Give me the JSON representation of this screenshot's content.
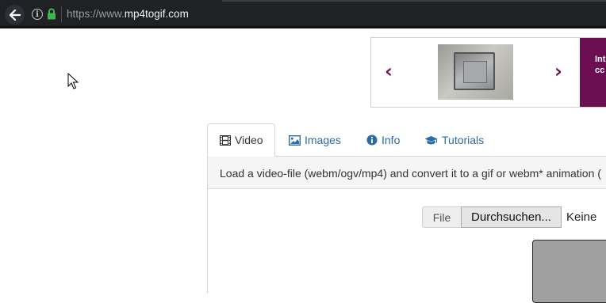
{
  "browser": {
    "url_prefix": "https://www.",
    "url_domain": "mp4togif.com"
  },
  "carousel": {
    "panel_text": "Int\ncc"
  },
  "tabs": [
    {
      "label": "Video",
      "icon": "film-icon",
      "active": true
    },
    {
      "label": "Images",
      "icon": "image-icon",
      "active": false
    },
    {
      "label": "Info",
      "icon": "info-circle-icon",
      "active": false
    },
    {
      "label": "Tutorials",
      "icon": "graduation-cap-icon",
      "active": false
    }
  ],
  "panel": {
    "description": "Load a video-file (webm/ogv/mp4) and convert it to a gif or webm* animation (",
    "file_label": "File",
    "browse_label": "Durchsuchen...",
    "no_file_text": "Keine"
  },
  "colors": {
    "brand": "#6b0f52",
    "link": "#2a6aa8",
    "chrome_bg": "#1f2125"
  }
}
